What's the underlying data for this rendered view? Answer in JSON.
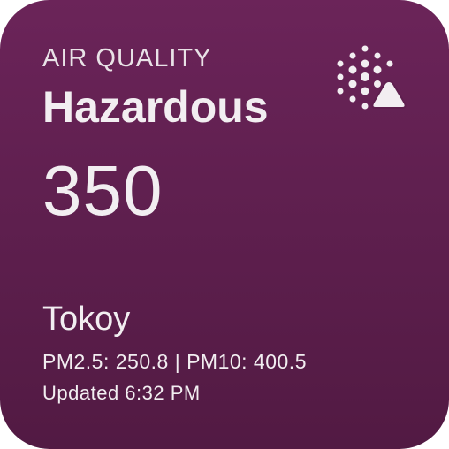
{
  "widget": {
    "label": "AIR QUALITY",
    "status": "Hazardous",
    "aqi": "350",
    "city": "Tokoy",
    "pollutants": "PM2.5: 250.8 | PM10: 400.5",
    "updated": "Updated 6:32 PM",
    "icon": "air-quality-warning-icon",
    "colors": {
      "background": "#5e1f4e",
      "text": "#f2eef1"
    }
  }
}
